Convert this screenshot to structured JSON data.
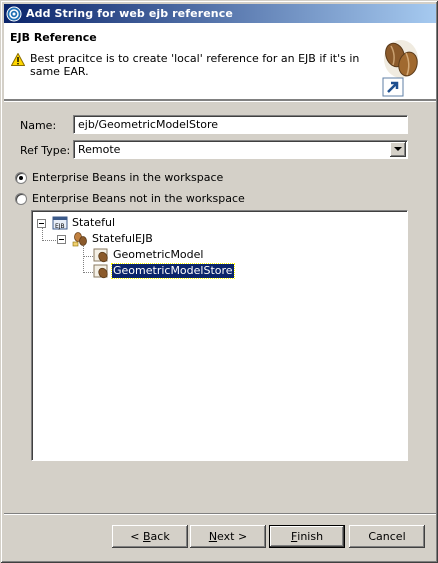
{
  "window": {
    "title": "Add String for web ejb reference"
  },
  "banner": {
    "heading": "EJB Reference",
    "message": "Best pracitce is to create 'local' reference for an EJB if it's in same EAR."
  },
  "form": {
    "name_label": "Name:",
    "name_value": "ejb/GeometricModelStore",
    "ref_type_label": "Ref Type:",
    "ref_type_value": "Remote"
  },
  "options": {
    "in_workspace": "Enterprise Beans in the workspace",
    "not_in_workspace": "Enterprise Beans not in the workspace",
    "selected": "in_workspace"
  },
  "tree": {
    "root": "Stateful",
    "module": "StatefulEJB",
    "beans": [
      "GeometricModel",
      "GeometricModelStore"
    ],
    "selected": "GeometricModelStore"
  },
  "buttons": {
    "back": {
      "prefix": "< ",
      "mnemonic": "B",
      "rest": "ack"
    },
    "next": {
      "mnemonic": "N",
      "rest": "ext >"
    },
    "finish": {
      "mnemonic": "F",
      "rest": "inish"
    },
    "cancel": "Cancel"
  }
}
